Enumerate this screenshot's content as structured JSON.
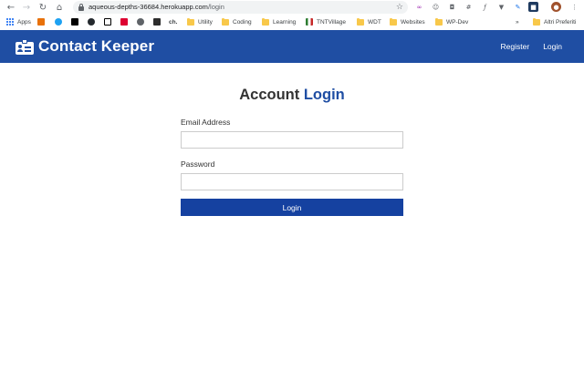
{
  "browser": {
    "url_host": "aqueous-depths-36684.herokuapp.com",
    "url_path": "/login",
    "bookmarks": [
      {
        "label": "Apps",
        "icon": "apps-grid-icon"
      },
      {
        "label": "",
        "icon": "wiki-icon"
      },
      {
        "label": "",
        "icon": "twitter-icon"
      },
      {
        "label": "",
        "icon": "dev-icon"
      },
      {
        "label": "",
        "icon": "github-icon"
      },
      {
        "label": "",
        "icon": "codepen-icon"
      },
      {
        "label": "",
        "icon": "angular-icon"
      },
      {
        "label": "",
        "icon": "circle-icon"
      },
      {
        "label": "",
        "icon": "terminal-icon"
      },
      {
        "label": "ch.",
        "icon": "ch-icon"
      },
      {
        "label": "Utility",
        "icon": "folder-icon"
      },
      {
        "label": "Coding",
        "icon": "folder-icon"
      },
      {
        "label": "Learning",
        "icon": "folder-icon"
      },
      {
        "label": "TNTVillage",
        "icon": "tntvillage-icon"
      },
      {
        "label": "WDT",
        "icon": "folder-icon"
      },
      {
        "label": "Websites",
        "icon": "folder-icon"
      },
      {
        "label": "WP-Dev",
        "icon": "folder-icon"
      },
      {
        "label": "»",
        "icon": "overflow-icon"
      },
      {
        "label": "Altri Preferiti",
        "icon": "folder-icon"
      }
    ]
  },
  "navbar": {
    "brand": "Contact Keeper",
    "links": [
      "Register",
      "Login"
    ]
  },
  "login": {
    "heading_prefix": "Account",
    "heading_accent": "Login",
    "email_label": "Email Address",
    "email_value": "",
    "password_label": "Password",
    "password_value": "",
    "submit_label": "Login"
  },
  "colors": {
    "navbar": "#1f4ea3",
    "accent": "#1f4ea3",
    "button": "#1541a0"
  }
}
